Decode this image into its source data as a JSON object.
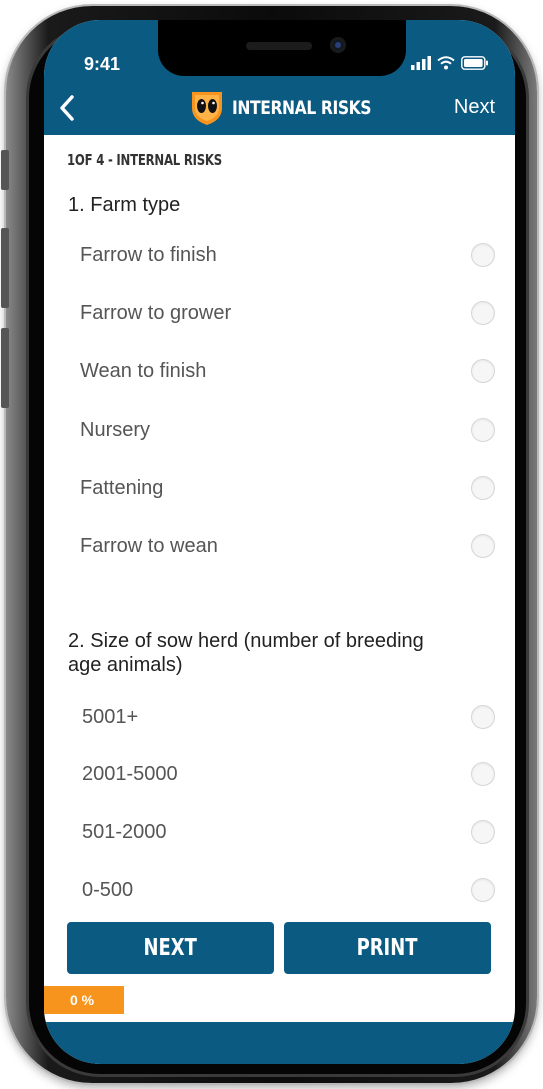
{
  "status_bar": {
    "time": "9:41"
  },
  "header": {
    "title": "INTERNAL RISKS",
    "next_label": "Next"
  },
  "step_label": "1OF 4 - INTERNAL RISKS",
  "questions": [
    {
      "title": "1. Farm type",
      "options": [
        "Farrow to finish",
        "Farrow to grower",
        "Wean to finish",
        "Nursery",
        "Fattening",
        "Farrow to wean"
      ]
    },
    {
      "title_line1": "2. Size of sow herd (number of breeding",
      "title_line2": "age animals)",
      "options": [
        "5001+",
        "2001-5000",
        "501-2000",
        "0-500"
      ]
    }
  ],
  "buttons": {
    "next": "NEXT",
    "print": "PRINT"
  },
  "progress": {
    "label": "0 %",
    "percent": 0
  },
  "colors": {
    "brand": "#0b5a82",
    "accent": "#f7941d"
  }
}
